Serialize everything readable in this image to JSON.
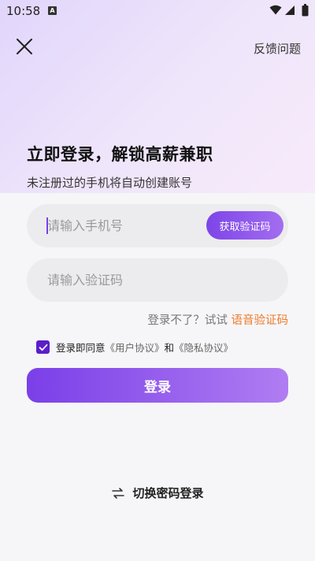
{
  "status_bar": {
    "time": "10:58",
    "badge": "A"
  },
  "header": {
    "feedback_label": "反馈问题"
  },
  "hero": {
    "title": "立即登录，解锁高薪兼职",
    "subtitle": "未注册过的手机将自动创建账号"
  },
  "form": {
    "phone_placeholder": "请输入手机号",
    "get_code_label": "获取验证码",
    "code_placeholder": "请输入验证码",
    "voice_prompt": "登录不了？试试",
    "voice_link": "语音验证码",
    "agree_prefix": "登录即同意",
    "user_agreement": "《用户协议》",
    "and_text": "和",
    "privacy_agreement": "《隐私协议》",
    "agreement_checked": true,
    "login_label": "登录"
  },
  "footer": {
    "switch_label": "切换密码登录"
  },
  "colors": {
    "accent": "#7b3fe8",
    "link_orange": "#ef7a2c",
    "checkbox": "#5a1fc9"
  }
}
